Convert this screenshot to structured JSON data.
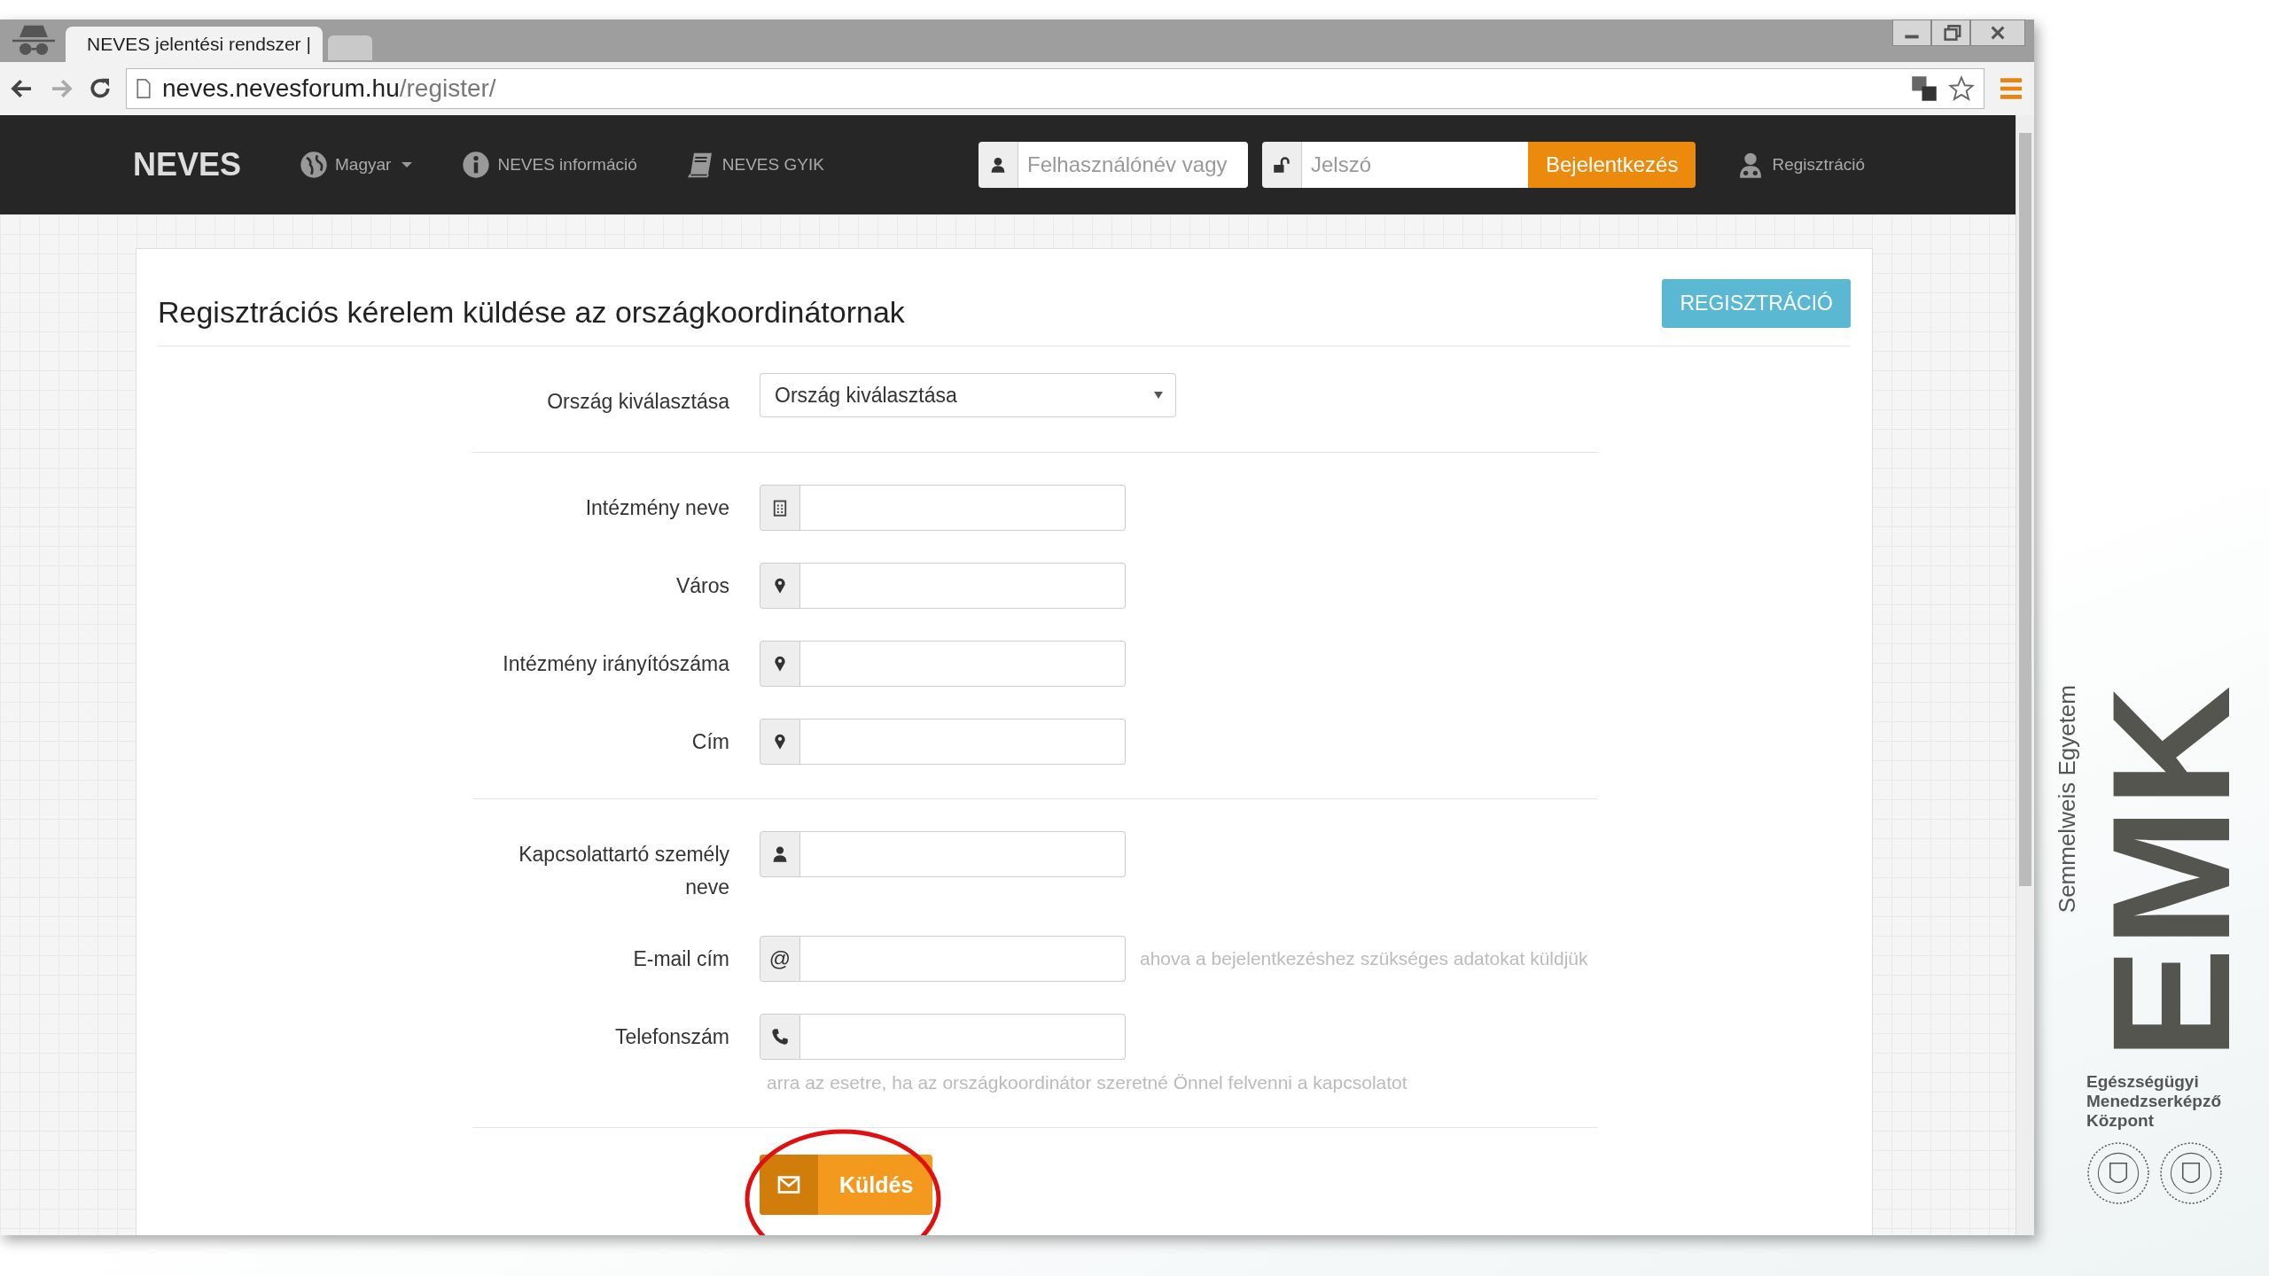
{
  "browser": {
    "tab_title": "NEVES jelentési rendszer |",
    "url_host": "neves.nevesforum.hu",
    "url_path": "/register/"
  },
  "navbar": {
    "brand": "NEVES",
    "language": "Magyar",
    "links": [
      {
        "kind": "info",
        "label": "NEVES információ"
      },
      {
        "kind": "book",
        "label": "NEVES GYIK"
      }
    ],
    "username_placeholder": "Felhasználónév vagy",
    "password_placeholder": "Jelszó",
    "login_button": "Bejelentkezés",
    "register_link": "Regisztráció"
  },
  "form": {
    "title": "Regisztrációs kérelem küldése az országkoordinátornak",
    "register_button": "REGISZTRÁCIÓ",
    "country": {
      "label": "Ország kiválasztása",
      "value": "Ország kiválasztása"
    },
    "groups": [
      [
        {
          "label": "Intézmény neve",
          "addon": {
            "kind": "building"
          }
        },
        {
          "label": "Város",
          "addon": {
            "kind": "pin"
          }
        },
        {
          "label": "Intézmény irányítószáma",
          "addon": {
            "kind": "pin"
          }
        },
        {
          "label": "Cím",
          "addon": {
            "kind": "pin"
          }
        }
      ],
      [
        {
          "label": "Kapcsolattartó személy neve",
          "addon": {
            "kind": "person"
          }
        },
        {
          "label": "E-mail cím",
          "addon": {
            "kind": "text",
            "text": "@"
          },
          "help": {
            "kind": "inline",
            "text": "ahova a bejelentkezéshez szükséges adatokat küldjük"
          }
        },
        {
          "label": "Telefonszám",
          "addon": {
            "kind": "phone"
          },
          "help": {
            "kind": "below",
            "text": "arra az esetre, ha az országkoordinátor szeretné Önnel felvenni a kapcsolatot"
          }
        }
      ]
    ],
    "submit": {
      "label": "Küldés",
      "highlighted": true
    }
  },
  "logo": {
    "university": "Semmelweis Egyetem",
    "mark": "EMK",
    "center_lines": [
      "Egészségügyi",
      "Menedzserképző",
      "Központ"
    ]
  }
}
